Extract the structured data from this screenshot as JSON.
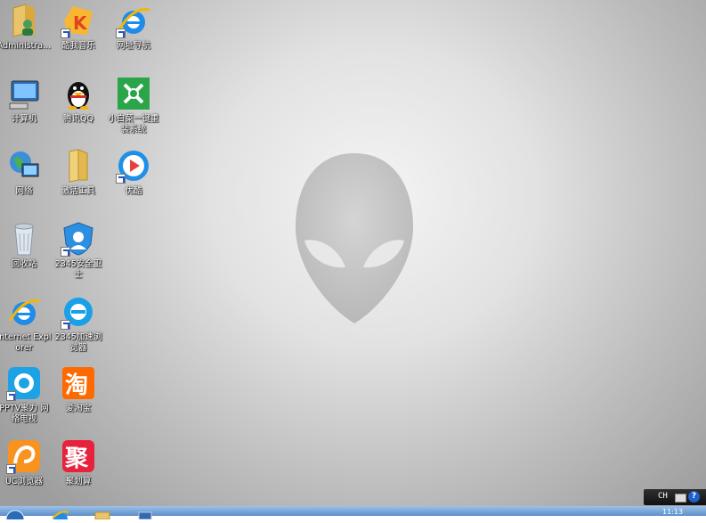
{
  "desktop": {
    "icons": [
      {
        "label": "Administra...",
        "icon": "user-folder-icon",
        "shortcut": false
      },
      {
        "label": "酷我音乐",
        "icon": "kuwo-music-icon",
        "shortcut": true
      },
      {
        "label": "网址导航",
        "icon": "ie-browser-icon",
        "shortcut": true
      },
      {
        "label": "计算机",
        "icon": "computer-icon",
        "shortcut": false
      },
      {
        "label": "腾讯QQ",
        "icon": "qq-penguin-icon",
        "shortcut": false
      },
      {
        "label": "小白菜一键重装系统",
        "icon": "xiaobaicai-icon",
        "shortcut": false
      },
      {
        "label": "网络",
        "icon": "network-icon",
        "shortcut": false
      },
      {
        "label": "激活工具",
        "icon": "folder-icon",
        "shortcut": false
      },
      {
        "label": "优酷",
        "icon": "youku-icon",
        "shortcut": true
      },
      {
        "label": "回收站",
        "icon": "recycle-bin-icon",
        "shortcut": false
      },
      {
        "label": "2345安全卫士",
        "icon": "shield-icon",
        "shortcut": true
      },
      {
        "label": "Internet Explorer",
        "icon": "ie-icon",
        "shortcut": false
      },
      {
        "label": "2345加速浏览器",
        "icon": "browser-2345-icon",
        "shortcut": true
      },
      {
        "label": "PPTV聚力 网络电视",
        "icon": "pptv-icon",
        "shortcut": true
      },
      {
        "label": "爱淘宝",
        "icon": "taobao-icon",
        "shortcut": false
      },
      {
        "label": "UC浏览器",
        "icon": "uc-browser-icon",
        "shortcut": true
      },
      {
        "label": "聚划算",
        "icon": "juhuasuan-icon",
        "shortcut": false
      }
    ]
  },
  "tray": {
    "lang": "CH",
    "help": "?",
    "clock": "11:13"
  },
  "colors": {
    "accent": "#1f5fcc",
    "taskbar": "#5b8fc7"
  }
}
